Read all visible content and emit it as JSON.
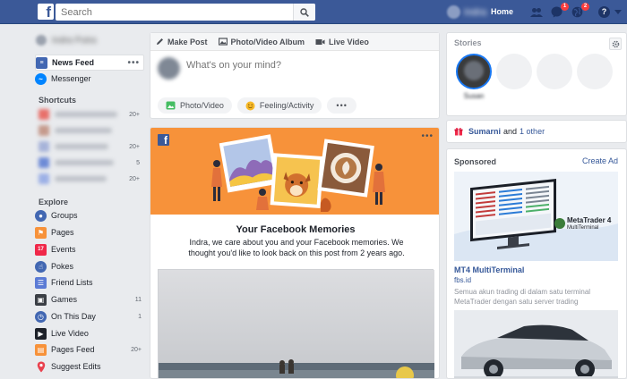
{
  "topbar": {
    "search_placeholder": "Search",
    "username": "Indra",
    "home_label": "Home",
    "messages_badge": "1",
    "notifications_badge": "2",
    "help_label": "?"
  },
  "sidebar": {
    "profile_name": "Indra Putra",
    "items_top": [
      {
        "label": "News Feed",
        "more": "•••"
      },
      {
        "label": "Messenger"
      }
    ],
    "shortcuts_heading": "Shortcuts",
    "shortcuts_counts": [
      "20+",
      "",
      "20+",
      "5",
      "20+"
    ],
    "explore_heading": "Explore",
    "explore_items": [
      {
        "label": "Groups",
        "count": ""
      },
      {
        "label": "Pages",
        "count": ""
      },
      {
        "label": "Events",
        "count": ""
      },
      {
        "label": "Pokes",
        "count": ""
      },
      {
        "label": "Friend Lists",
        "count": ""
      },
      {
        "label": "Games",
        "count": "11"
      },
      {
        "label": "On This Day",
        "count": "1"
      },
      {
        "label": "Live Video",
        "count": ""
      },
      {
        "label": "Pages Feed",
        "count": "20+"
      },
      {
        "label": "Suggest Edits",
        "count": ""
      }
    ]
  },
  "composer": {
    "tabs": [
      "Make Post",
      "Photo/Video Album",
      "Live Video"
    ],
    "placeholder": "What's on your mind?",
    "actions": [
      "Photo/Video",
      "Feeling/Activity"
    ],
    "more": "•••"
  },
  "memory": {
    "more": "•••",
    "title": "Your Facebook Memories",
    "text": "Indra, we care about you and your Facebook memories. We thought you'd like to look back on this post from 2 years ago."
  },
  "stories": {
    "title": "Stories",
    "story_name": "Susan"
  },
  "birthday": {
    "name": "Sumarni",
    "and": "and",
    "other": "1 other"
  },
  "sponsored": {
    "title": "Sponsored",
    "create_ad": "Create Ad",
    "ad_brand": "MetaTrader 4",
    "ad_brand_sub": "MultiTerminal",
    "ad_title": "MT4 MultiTerminal",
    "ad_domain": "fbs.id",
    "ad_desc": "Semua akun trading di dalam satu terminal MetaTrader dengan satu server trading"
  },
  "colors": {
    "fb_blue": "#3b5998",
    "link_blue": "#365899",
    "memory_orange": "#f7923a",
    "badge_red": "#fa3e3e"
  }
}
